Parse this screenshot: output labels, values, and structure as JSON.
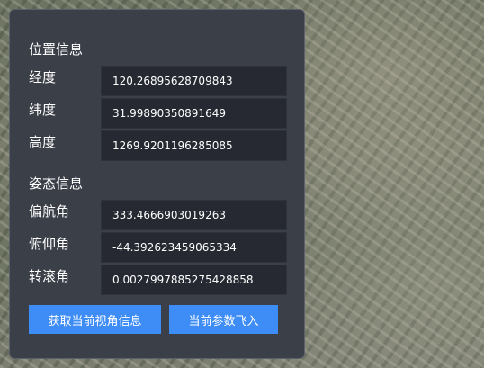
{
  "panel": {
    "position_section": {
      "title": "位置信息",
      "fields": [
        {
          "label": "经度",
          "value": "120.26895628709843"
        },
        {
          "label": "纬度",
          "value": "31.99890350891649"
        },
        {
          "label": "高度",
          "value": "1269.9201196285085"
        }
      ]
    },
    "attitude_section": {
      "title": "姿态信息",
      "fields": [
        {
          "label": "偏航角",
          "value": "333.4666903019263"
        },
        {
          "label": "俯仰角",
          "value": "-44.392623459065334"
        },
        {
          "label": "转滚角",
          "value": "0.0027997885275428858"
        }
      ]
    },
    "buttons": {
      "get_view": "获取当前视角信息",
      "fly_to": "当前参数飞入"
    }
  },
  "colors": {
    "panel_bg": "#3b3f48",
    "field_bg": "#262931",
    "button_bg": "#3e8cf5"
  }
}
